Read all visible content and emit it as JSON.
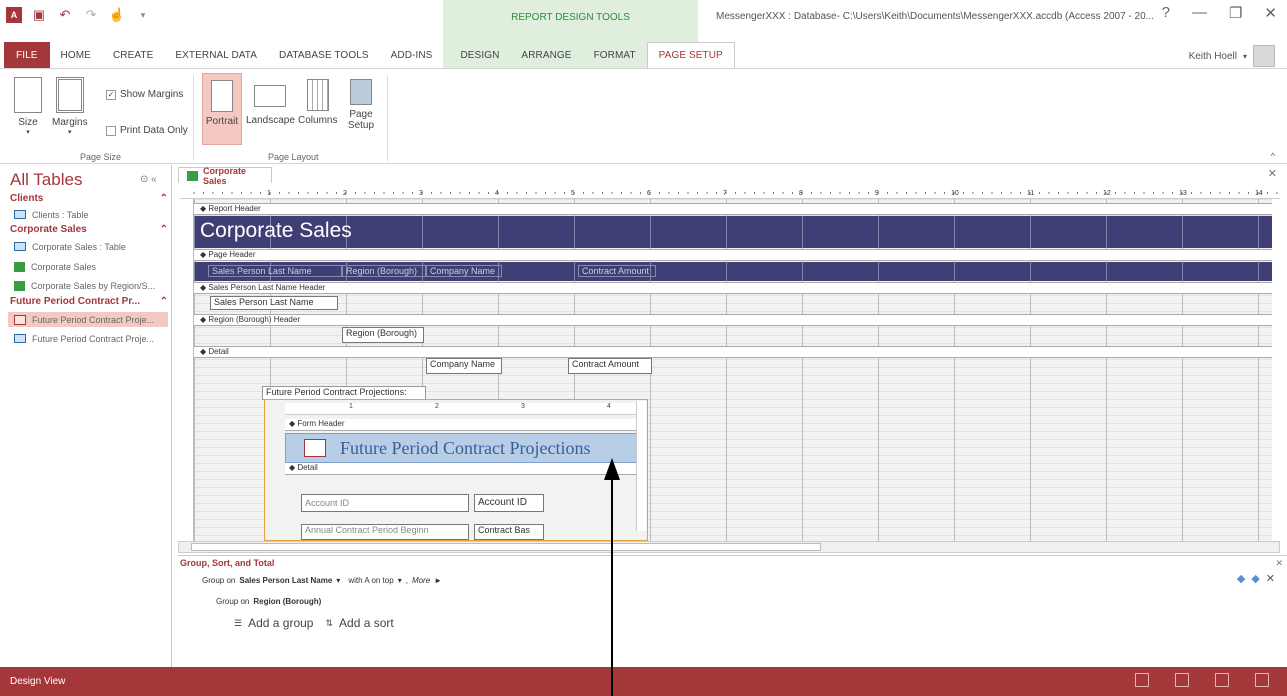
{
  "titlebar": {
    "context_label": "REPORT DESIGN TOOLS",
    "window_title": "MessengerXXX : Database- C:\\Users\\Keith\\Documents\\MessengerXXX.accdb (Access 2007 - 20...",
    "help": "?"
  },
  "tabs": [
    "FILE",
    "HOME",
    "CREATE",
    "EXTERNAL DATA",
    "DATABASE TOOLS",
    "ADD-INS",
    "DESIGN",
    "ARRANGE",
    "FORMAT",
    "PAGE SETUP"
  ],
  "user": {
    "name": "Keith Hoell"
  },
  "ribbon": {
    "size": "Size",
    "margins": "Margins",
    "show_margins": "Show Margins",
    "print_data_only": "Print Data Only",
    "portrait": "Portrait",
    "landscape": "Landscape",
    "columns": "Columns",
    "page_setup": "Page Setup",
    "group_page_size": "Page Size",
    "group_page_layout": "Page Layout"
  },
  "nav": {
    "title": "All Tables",
    "groups": [
      {
        "name": "Clients",
        "items": [
          "Clients : Table"
        ]
      },
      {
        "name": "Corporate Sales",
        "items": [
          "Corporate Sales : Table",
          "Corporate Sales",
          "Corporate Sales by Region/S..."
        ]
      },
      {
        "name": "Future Period Contract Pr...",
        "items": [
          "Future Period Contract Proje...",
          "Future Period Contract Proje..."
        ]
      }
    ]
  },
  "doc": {
    "tab": "Corporate Sales"
  },
  "ruler_marks": [
    "1",
    "2",
    "3",
    "4",
    "5",
    "6",
    "7",
    "8",
    "9",
    "10",
    "11",
    "12",
    "13",
    "14"
  ],
  "report": {
    "report_header": "Report Header",
    "title": "Corporate Sales",
    "page_header": "Page Header",
    "ph_labels": [
      "Sales Person Last Name",
      "Region (Borough)",
      "Company Name",
      "Contract Amount"
    ],
    "sp_header": "Sales Person Last Name Header",
    "sp_control": "Sales Person Last Name",
    "region_header": "Region (Borough) Header",
    "region_control": "Region (Borough)",
    "detail": "Detail",
    "company_control": "Company Name",
    "amount_control": "Contract Amount",
    "subform_label": "Future Period Contract Projections:"
  },
  "subform": {
    "ruler": [
      "1",
      "2",
      "3",
      "4"
    ],
    "form_header": "Form Header",
    "title": "Future Period Contract Projections",
    "detail": "Detail",
    "account_label": "Account ID",
    "account_field": "Account ID",
    "annual_label": "Annual Contract Period Beginn",
    "annual_field": "Contract Bas"
  },
  "gst": {
    "title": "Group, Sort, and Total",
    "g1_prefix": "Group on",
    "g1_field": "Sales Person Last Name",
    "g1_sort": "with A on top",
    "g1_more": "More",
    "g2_prefix": "Group on",
    "g2_field": "Region (Borough)",
    "add_group": "Add a group",
    "add_sort": "Add a sort"
  },
  "status": {
    "text": "Design View"
  },
  "colors": {
    "accent": "#a4373a",
    "band": "#3f3f76",
    "context": "#2e8b3e"
  }
}
